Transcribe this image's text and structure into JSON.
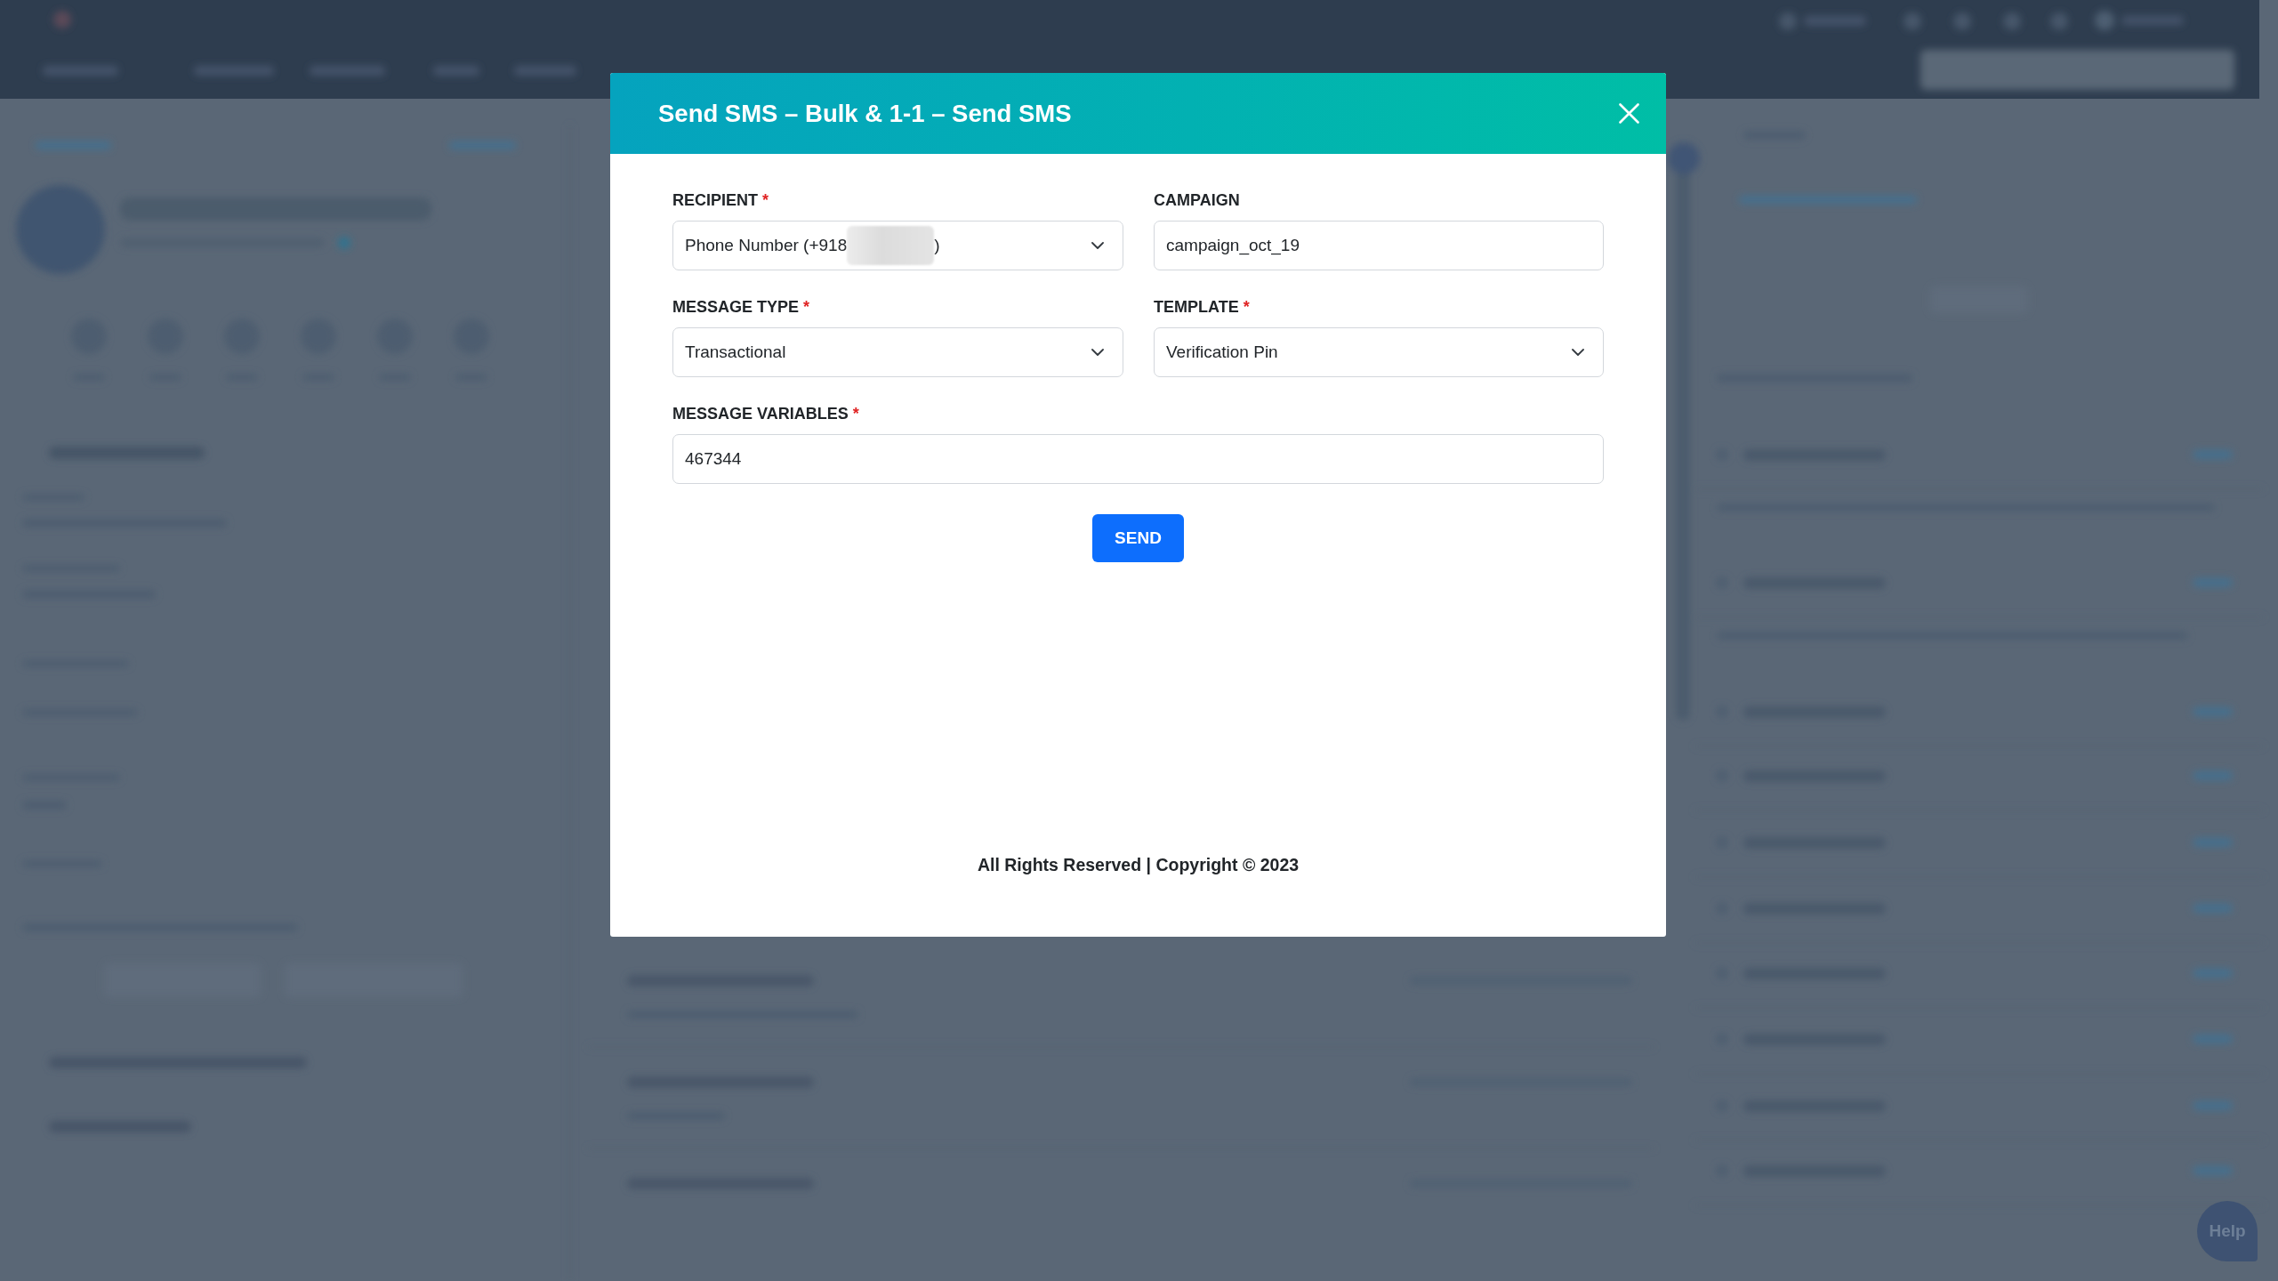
{
  "dialog": {
    "title": "Send SMS – Bulk & 1-1 – Send SMS",
    "fields": [
      {
        "label": "RECIPIENT",
        "required_mark": "*",
        "kind": "select",
        "value": "Phone Number (+918",
        "redacted": true,
        "value_end": ")"
      },
      {
        "label": "CAMPAIGN",
        "kind": "text",
        "value": "campaign_oct_19"
      },
      {
        "label": "MESSAGE TYPE",
        "required_mark": "*",
        "kind": "select",
        "value": "Transactional"
      },
      {
        "label": "TEMPLATE",
        "required_mark": "*",
        "kind": "select",
        "value": "Verification Pin"
      },
      {
        "label": "MESSAGE VARIABLES",
        "required_mark": "*",
        "kind": "text",
        "value": "467344"
      }
    ],
    "send_button": "SEND",
    "footer": "All Rights Reserved | Copyright © 2023"
  },
  "help_button": "Help"
}
